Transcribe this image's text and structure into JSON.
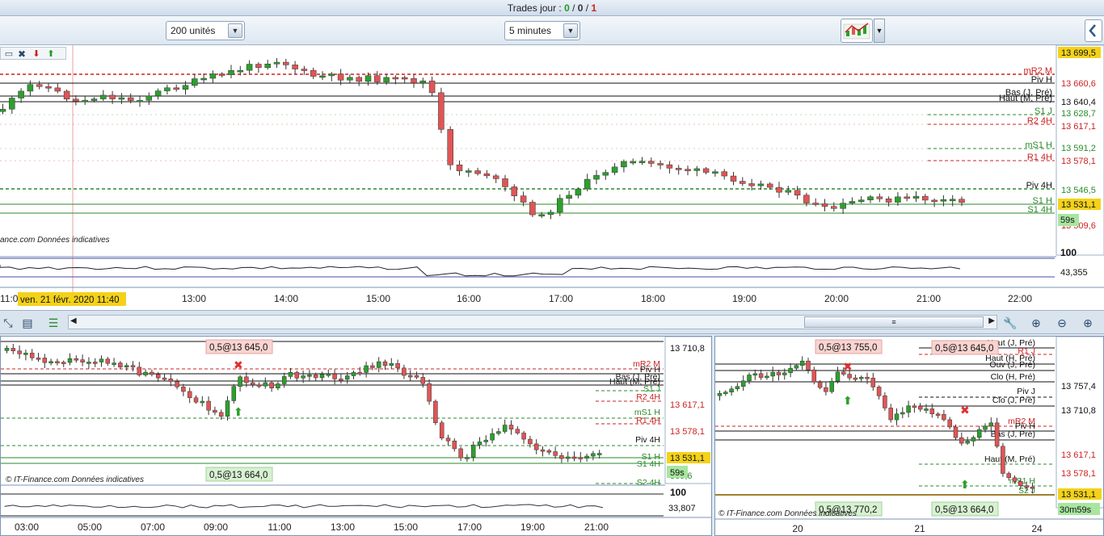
{
  "topbar": {
    "label": "Trades jour : ",
    "winners": "0",
    "sep1": " / ",
    "neutral": "0",
    "sep2": " / ",
    "losers": "1"
  },
  "toolbar": {
    "quantity": "200 unités",
    "timeframe": "5 minutes",
    "chart_type_icon": "candlestick-chart-icon"
  },
  "colors": {
    "up": "#2ca02c",
    "down": "#e05555",
    "red_level": "#cc2222",
    "green_level": "#2b8a2b",
    "highlight": "#f4d21a",
    "timer": "#a8e6a0"
  },
  "main_chart": {
    "price_labels": [
      "13 699,5",
      "13 660,6",
      "13 640,4",
      "13 628,7",
      "13 617,1",
      "13 591,2",
      "13 578,1",
      "13 546,5",
      "13 531,1",
      "13 509,6"
    ],
    "current_price": "13 531,1",
    "countdown": "59s",
    "levels": [
      {
        "label": "mR2 M",
        "color": "red"
      },
      {
        "label": "Piv H",
        "color": "black"
      },
      {
        "label": "Bas (J, Pré)",
        "color": "black"
      },
      {
        "label": "Haut (M, Pré)",
        "color": "black"
      },
      {
        "label": "S1 J",
        "color": "green"
      },
      {
        "label": "R2 4H",
        "color": "red"
      },
      {
        "label": "mS1 H",
        "color": "green"
      },
      {
        "label": "R1 4H",
        "color": "red"
      },
      {
        "label": "Piv 4H",
        "color": "black"
      },
      {
        "label": "S1 H",
        "color": "green"
      },
      {
        "label": "S1 4H",
        "color": "green"
      }
    ],
    "watermark": "ance.com  Données indicatives",
    "date_marker": "ven. 21 févr. 2020 11:40",
    "x_labels": [
      "11:0",
      "13:00",
      "14:00",
      "15:00",
      "16:00",
      "17:00",
      "18:00",
      "19:00",
      "20:00",
      "21:00",
      "22:00"
    ],
    "osc_max": "100",
    "osc_value": "43,355"
  },
  "bottom_left_chart": {
    "price_labels": [
      "13 710,8",
      "13 617,1",
      "13 578,1",
      "13 531,1",
      "509,6"
    ],
    "current_price": "13 531,1",
    "countdown": "59s",
    "levels": [
      {
        "label": "mR2 M"
      },
      {
        "label": "Piv H"
      },
      {
        "label": "Bas (J, Pré)"
      },
      {
        "label": "Haut (M, Pré)"
      },
      {
        "label": "S1 J"
      },
      {
        "label": "R2 4H"
      },
      {
        "label": "mS1 H"
      },
      {
        "label": "R1 4H"
      },
      {
        "label": "Piv 4H"
      },
      {
        "label": "S1 H"
      },
      {
        "label": "S1 4H"
      },
      {
        "label": "S2 4H"
      }
    ],
    "trade_labels": [
      "0,5@13 645,0",
      "0,5@13 664,0"
    ],
    "watermark": "© IT-Finance.com  Données indicatives",
    "x_labels": [
      "03:00",
      "05:00",
      "07:00",
      "09:00",
      "11:00",
      "13:00",
      "15:00",
      "17:00",
      "19:00",
      "21:00"
    ],
    "osc_max": "100",
    "osc_value": "33,807"
  },
  "bottom_right_chart": {
    "price_labels": [
      "13 757,4",
      "13 710,8",
      "13 617,1",
      "13 578,1",
      "13 531,1"
    ],
    "current_price": "13 531,1",
    "countdown": "30m59s",
    "levels": [
      {
        "label": "Haut (J, Pré)"
      },
      {
        "label": "R1 J"
      },
      {
        "label": "Haut (H, Pré)"
      },
      {
        "label": "Ouv (J, Pré)"
      },
      {
        "label": "Clo (H, Pré)"
      },
      {
        "label": "Piv J"
      },
      {
        "label": "Clo (J, Pré)"
      },
      {
        "label": "mR2 M"
      },
      {
        "label": "Piv H"
      },
      {
        "label": "Bas (J, Pré)"
      },
      {
        "label": "Haut (M, Pré)"
      },
      {
        "label": "mS1 H"
      },
      {
        "label": "S2 J"
      }
    ],
    "trade_labels": [
      "0,5@13 755,0",
      "0,5@13 645,0",
      "0,5@13 770,2",
      "0,5@13 664,0"
    ],
    "watermark": "© IT-Finance.com  Données indicatives",
    "x_labels": [
      "20",
      "21",
      "24"
    ]
  }
}
